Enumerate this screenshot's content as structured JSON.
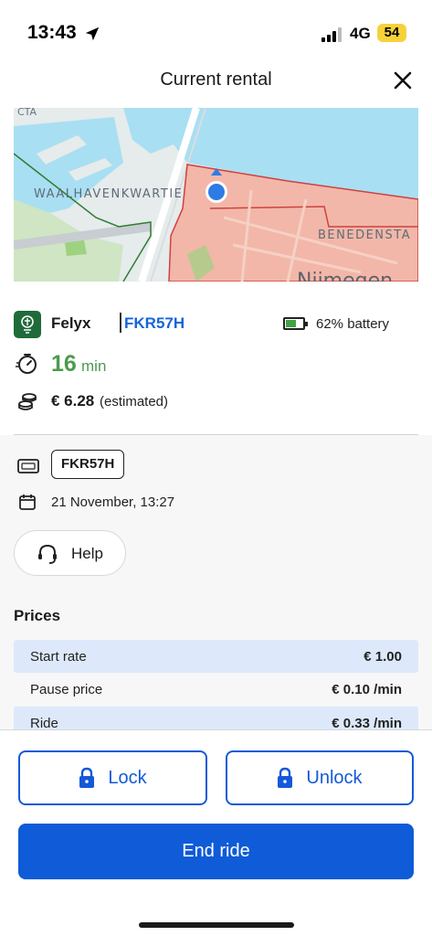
{
  "status": {
    "time": "13:43",
    "network": "4G",
    "battery": "54"
  },
  "header": {
    "title": "Current rental"
  },
  "map": {
    "labels": [
      "CTA",
      "WAALHAVENKWARTIE",
      "BENEDENSTA",
      "Nijmegen"
    ]
  },
  "operator": {
    "brand": "Felyx",
    "plate": "FKR57H",
    "battery_text": "62% battery",
    "battery_level": 0.62
  },
  "timer": {
    "value": "16",
    "unit": "min"
  },
  "cost": {
    "value": "€ 6.28",
    "note": "(estimated)"
  },
  "details": {
    "plate": "FKR57H",
    "date": "21 November, 13:27",
    "help_label": "Help"
  },
  "prices": {
    "title": "Prices",
    "rows": [
      {
        "label": "Start rate",
        "value": "€ 1.00"
      },
      {
        "label": "Pause price",
        "value": "€ 0.10 /min"
      },
      {
        "label": "Ride",
        "value": "€ 0.33 /min"
      }
    ]
  },
  "actions": {
    "lock": "Lock",
    "unlock": "Unlock",
    "end": "End ride"
  },
  "colors": {
    "accent": "#0f5bd8",
    "timer": "#4c9b4e",
    "brand": "#1f6b3a",
    "zone": "#f2b7a8"
  }
}
